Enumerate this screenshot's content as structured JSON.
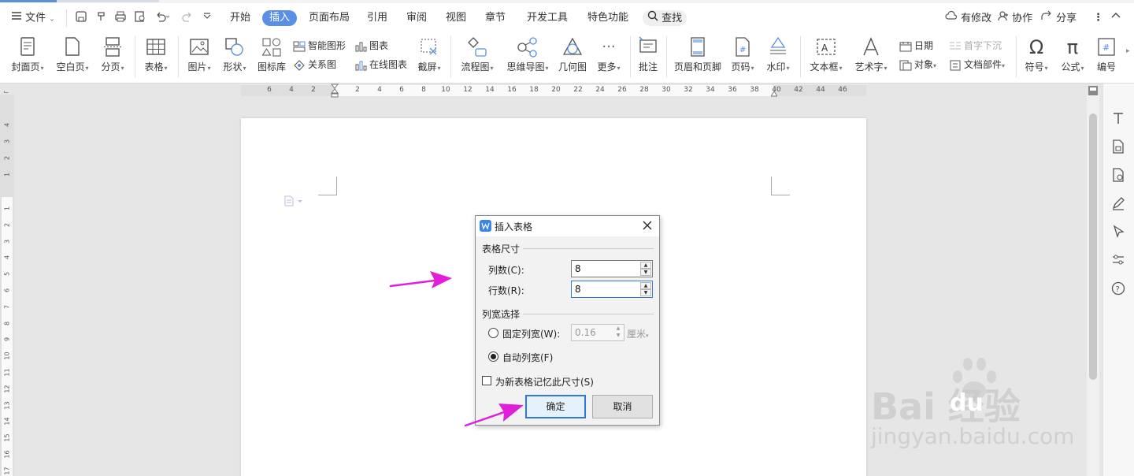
{
  "menu": {
    "file": "文件",
    "tabs": [
      "开始",
      "插入",
      "页面布局",
      "引用",
      "审阅",
      "视图",
      "章节",
      "开发工具",
      "特色功能"
    ],
    "active_tab": "插入",
    "search": "查找",
    "right": {
      "modify": "有修改",
      "collab": "协作",
      "share": "分享"
    }
  },
  "ribbon": {
    "cover": "封面页",
    "blank": "空白页",
    "pagebreak": "分页",
    "table": "表格",
    "picture": "图片",
    "shape": "形状",
    "iconlib": "图标库",
    "smartshape": "智能图形",
    "relation": "关系图",
    "chart": "图表",
    "onlinechart": "在线图表",
    "screenshot": "截屏",
    "flowchart": "流程图",
    "mindmap": "思维导图",
    "geometry": "几何图",
    "more": "更多",
    "comment": "批注",
    "headerfooter": "页眉和页脚",
    "pagenum": "页码",
    "watermark": "水印",
    "textbox": "文本框",
    "wordart": "艺术字",
    "date": "日期",
    "object": "对象",
    "dropcap": "首字下沉",
    "docpart": "文档部件",
    "symbol": "符号",
    "formula": "公式",
    "numbering": "编号"
  },
  "ruler": {
    "h_left": [
      "6",
      "4",
      "2"
    ],
    "h_right": [
      "2",
      "4",
      "6",
      "8",
      "10",
      "12",
      "14",
      "16",
      "18",
      "20",
      "22",
      "24",
      "26",
      "28",
      "30",
      "32",
      "34",
      "36",
      "38",
      "40",
      "42",
      "44",
      "46"
    ],
    "v_top": [
      "4",
      "3",
      "2",
      "1"
    ],
    "v_main": [
      "1",
      "2",
      "3",
      "4",
      "5",
      "6",
      "7",
      "8",
      "9",
      "10",
      "11",
      "12",
      "13",
      "14",
      "15",
      "16",
      "17"
    ]
  },
  "dialog": {
    "title": "插入表格",
    "group_size": "表格尺寸",
    "cols_label": "列数(C):",
    "cols_value": "8",
    "rows_label": "行数(R):",
    "rows_value": "8",
    "group_width": "列宽选择",
    "fixed_label": "固定列宽(W):",
    "fixed_value": "0.16",
    "fixed_unit": "厘米",
    "auto_label": "自动列宽(F)",
    "remember_label": "为新表格记忆此尺寸(S)",
    "ok": "确定",
    "cancel": "取消"
  },
  "watermark": {
    "main": "Bai 经验",
    "du": "du",
    "url": "jingyan.baidu.com"
  },
  "colors": {
    "accent": "#5a8fe6",
    "arrow": "#e020d8",
    "focus": "#2f7ad8"
  }
}
